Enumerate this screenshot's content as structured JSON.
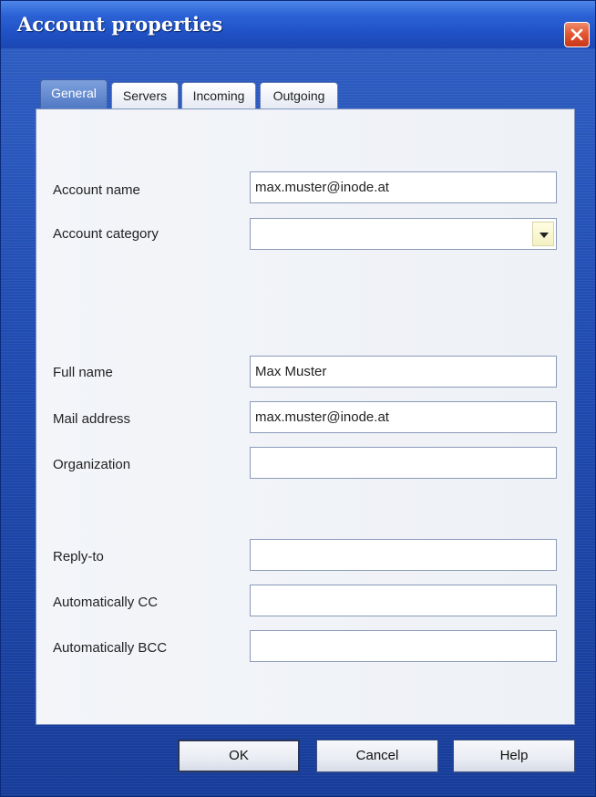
{
  "window": {
    "title": "Account properties"
  },
  "tabs": [
    {
      "label": "General",
      "active": true
    },
    {
      "label": "Servers",
      "active": false
    },
    {
      "label": "Incoming",
      "active": false
    },
    {
      "label": "Outgoing",
      "active": false
    }
  ],
  "form": {
    "account_name": {
      "label": "Account name",
      "value": "max.muster@inode.at"
    },
    "account_category": {
      "label": "Account category",
      "value": ""
    },
    "full_name": {
      "label": "Full name",
      "value": "Max Muster"
    },
    "mail_address": {
      "label": "Mail address",
      "value": "max.muster@inode.at"
    },
    "organization": {
      "label": "Organization",
      "value": ""
    },
    "reply_to": {
      "label": "Reply-to",
      "value": ""
    },
    "auto_cc": {
      "label": "Automatically CC",
      "value": ""
    },
    "auto_bcc": {
      "label": "Automatically BCC",
      "value": ""
    }
  },
  "buttons": {
    "ok": "OK",
    "cancel": "Cancel",
    "help": "Help"
  },
  "colors": {
    "titlebar": "#2c62d6",
    "active_tab": "#4f78c4",
    "close_button": "#e2552e"
  },
  "icons": {
    "close": "close-icon",
    "dropdown": "chevron-down-icon"
  }
}
